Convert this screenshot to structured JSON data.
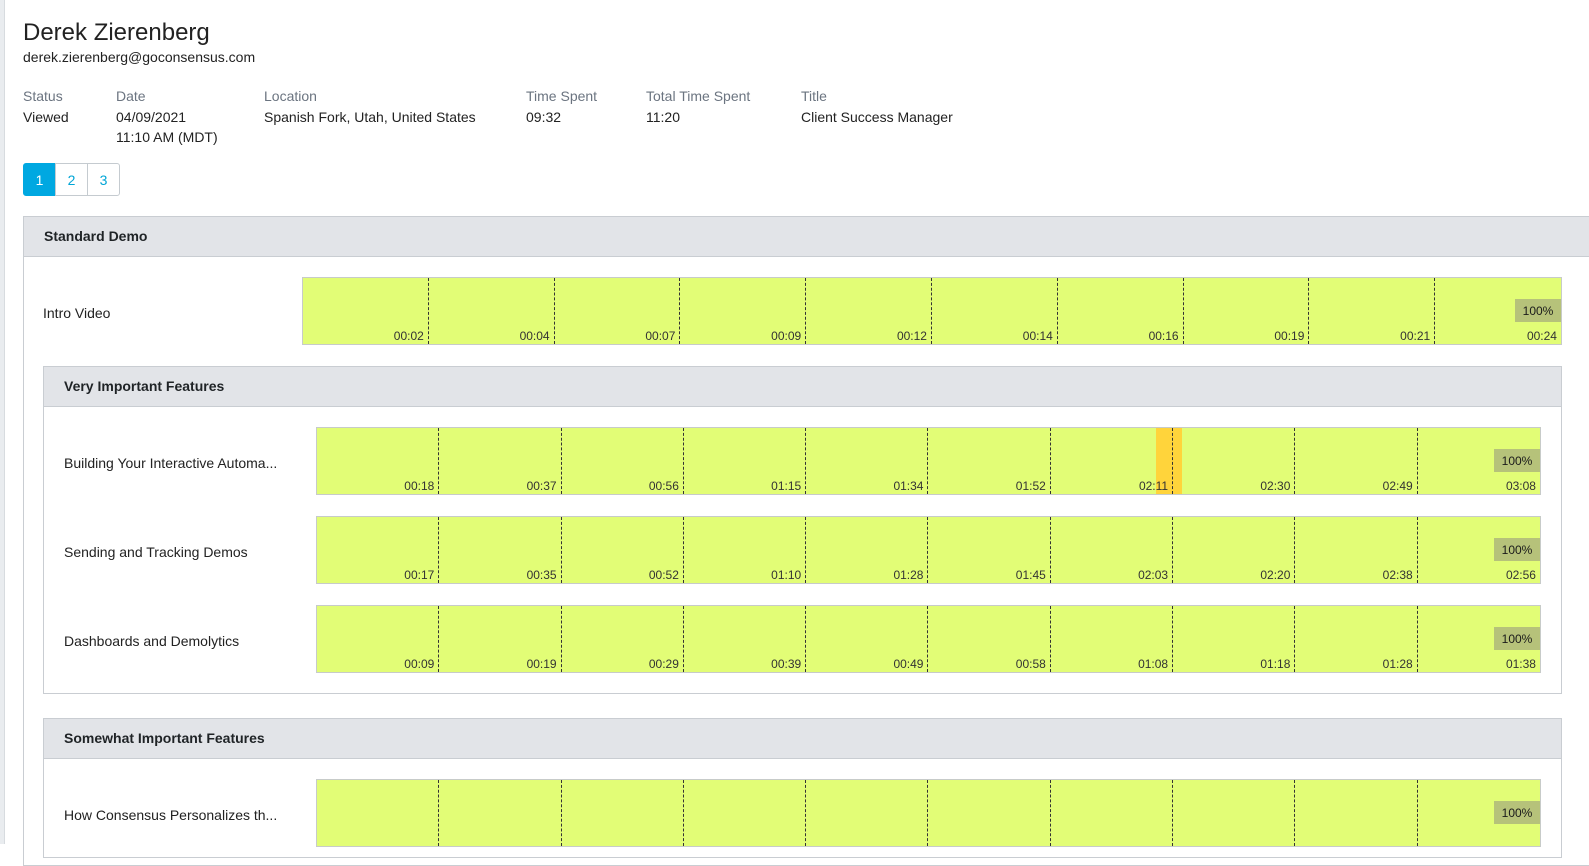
{
  "viewer": {
    "name": "Derek Zierenberg",
    "email": "derek.zierenberg@goconsensus.com"
  },
  "details": {
    "status_label": "Status",
    "status": "Viewed",
    "date_label": "Date",
    "date": "04/09/2021",
    "time": "11:10 AM (MDT)",
    "location_label": "Location",
    "location": "Spanish Fork, Utah, United States",
    "time_spent_label": "Time Spent",
    "time_spent": "09:32",
    "total_time_spent_label": "Total Time Spent",
    "total_time_spent": "11:20",
    "title_label": "Title",
    "title": "Client Success Manager"
  },
  "pager": {
    "pages": [
      "1",
      "2",
      "3"
    ],
    "active_page": "1"
  },
  "sections": {
    "standard_demo": {
      "title": "Standard Demo",
      "videos": [
        {
          "label": "Intro Video",
          "completion": "100%",
          "completion_fraction": 1.0,
          "ticks": [
            "00:02",
            "00:04",
            "00:07",
            "00:09",
            "00:12",
            "00:14",
            "00:16",
            "00:19",
            "00:21",
            "00:24"
          ]
        }
      ]
    },
    "very_important": {
      "title": "Very Important Features",
      "videos": [
        {
          "label": "Building Your Interactive Automa...",
          "completion": "100%",
          "completion_fraction": 1.0,
          "ticks": [
            "00:18",
            "00:37",
            "00:56",
            "01:15",
            "01:34",
            "01:52",
            "02:11",
            "02:30",
            "02:49",
            "03:08"
          ],
          "highlight": {
            "from": "02:09",
            "to": "02:13",
            "color": "#ffd43b"
          }
        },
        {
          "label": "Sending and Tracking Demos",
          "completion": "100%",
          "completion_fraction": 1.0,
          "ticks": [
            "00:17",
            "00:35",
            "00:52",
            "01:10",
            "01:28",
            "01:45",
            "02:03",
            "02:20",
            "02:38",
            "02:56"
          ]
        },
        {
          "label": "Dashboards and Demolytics",
          "completion": "100%",
          "completion_fraction": 1.0,
          "ticks": [
            "00:09",
            "00:19",
            "00:29",
            "00:39",
            "00:49",
            "00:58",
            "01:08",
            "01:18",
            "01:28",
            "01:38"
          ]
        }
      ]
    },
    "somewhat_important": {
      "title": "Somewhat Important Features",
      "videos": [
        {
          "label": "How Consensus Personalizes th...",
          "completion": "100%",
          "completion_fraction": 1.0
        }
      ]
    }
  },
  "colors": {
    "watched": "#e2fd76",
    "rewatched": "#ffd43b",
    "completion_badge": "#b6c27a",
    "accent": "#00a8e1"
  }
}
